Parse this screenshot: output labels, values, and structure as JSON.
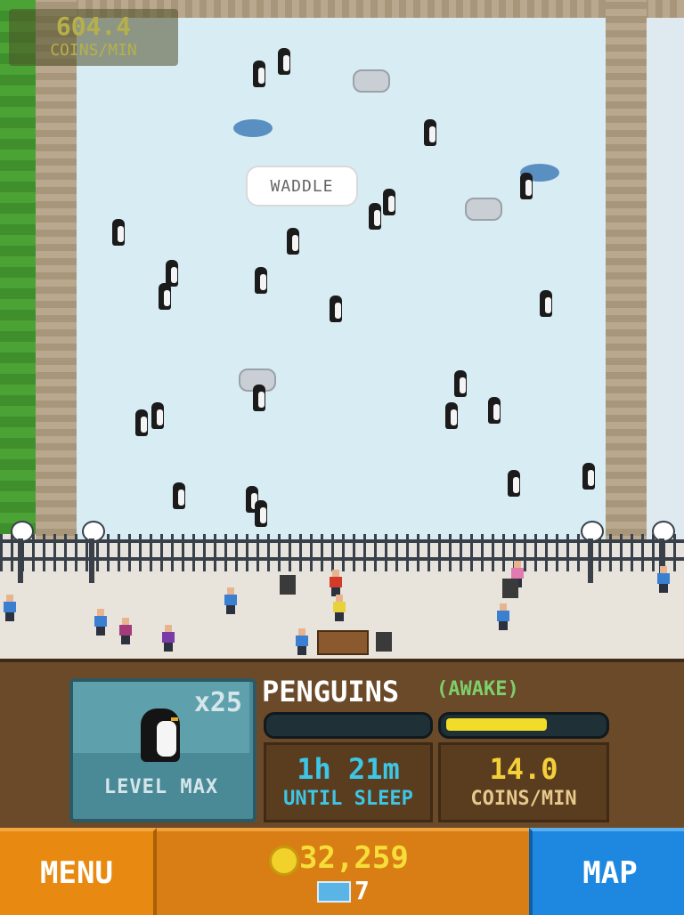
{
  "hud": {
    "coins_per_min": "604.4",
    "coins_unit": "COINS/MIN"
  },
  "bubble": {
    "text": "WADDLE"
  },
  "exhibit": {
    "name": "PENGUINS",
    "status": "(AWAKE)",
    "count": "x25",
    "level": "LEVEL MAX",
    "sleep_progress": 0.0,
    "coin_progress": 0.65,
    "time_value": "1h 21m",
    "time_label": "UNTIL SLEEP",
    "rate_value": "14.0",
    "rate_label": "COINS/MIN"
  },
  "bottom": {
    "menu_label": "MENU",
    "coins_total": "32,259",
    "zoo_bux": "7",
    "map_label": "MAP"
  },
  "colors": {
    "ice": "#d8ecf4",
    "coin": "#f2d12a",
    "awake": "#7fcf6a",
    "sleep_timer": "#3ec6e6",
    "menu": "#e88a12",
    "map": "#1e88e0"
  }
}
